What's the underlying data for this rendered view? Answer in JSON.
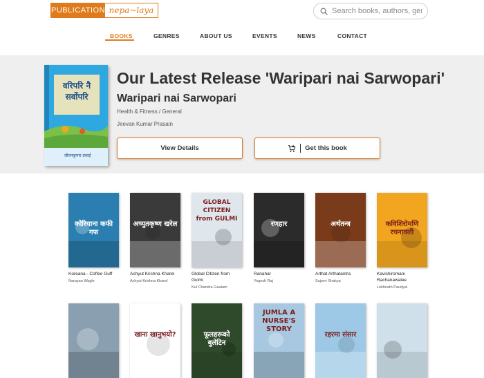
{
  "header": {
    "logo_left": "PUBLICATION",
    "logo_right": "nepa~laya",
    "search_placeholder": "Search books, authors, genres"
  },
  "nav": {
    "items": [
      "BOOKS",
      "GENRES",
      "ABOUT US",
      "EVENTS",
      "NEWS",
      "CONTACT"
    ],
    "active": "BOOKS"
  },
  "hero": {
    "heading": "Our Latest Release 'Waripari nai Sarwopari'",
    "book_title": "Waripari nai Sarwopari",
    "genre": "Health & Fitness / General",
    "author": "Jeevan Kumar Prasain",
    "cover_text": "वरिपरि नै सर्वोपरि",
    "cover_author": "जीवनकुमार प्रसाईं",
    "view_label": "View Details",
    "get_label": "Get this book"
  },
  "books": [
    {
      "title": "Koreana - Coffee Guff",
      "author": "Narayan Wagle",
      "cover_text": "कोरियाना कफी गफ",
      "bg": "#2a7fb0"
    },
    {
      "title": "Achyut Krishna Kharel",
      "author": "Achyut Krishna Kharel",
      "cover_text": "अच्युतकृष्ण खरेल",
      "bg": "#3a3a3a"
    },
    {
      "title": "Global Citizen from Gulmi",
      "author": "Kul Chandra Gautam",
      "cover_text": "GLOBAL CITIZEN from GULMI",
      "bg": "#dfe6ec"
    },
    {
      "title": "Ranahar",
      "author": "Yogesh Raj",
      "cover_text": "रणहार",
      "bg": "#2b2b2b"
    },
    {
      "title": "Arthat Arthatantra",
      "author": "Sujeev Shakya",
      "cover_text": "अर्थतन्त्र",
      "bg": "#7a3b1a"
    },
    {
      "title": "Kavishiromani Rachanawalee",
      "author": "Lekhnath Paudyal",
      "cover_text": "कविशिरोमणि रचनावली",
      "bg": "#f2a51f"
    },
    {
      "title": "",
      "author": "",
      "cover_text": "",
      "bg": "#8aa0b0"
    },
    {
      "title": "",
      "author": "",
      "cover_text": "खाना खानुभयो?",
      "bg": "#ffffff"
    },
    {
      "title": "",
      "author": "",
      "cover_text": "फूलहरूको बुलेटिन",
      "bg": "#2f4a2a"
    },
    {
      "title": "",
      "author": "",
      "cover_text": "JUMLA A NURSE'S STORY",
      "bg": "#a7c8e0"
    },
    {
      "title": "",
      "author": "",
      "cover_text": "रहरमा संसार",
      "bg": "#9ec9e6"
    },
    {
      "title": "",
      "author": "",
      "cover_text": "",
      "bg": "#cfe0ea"
    }
  ]
}
